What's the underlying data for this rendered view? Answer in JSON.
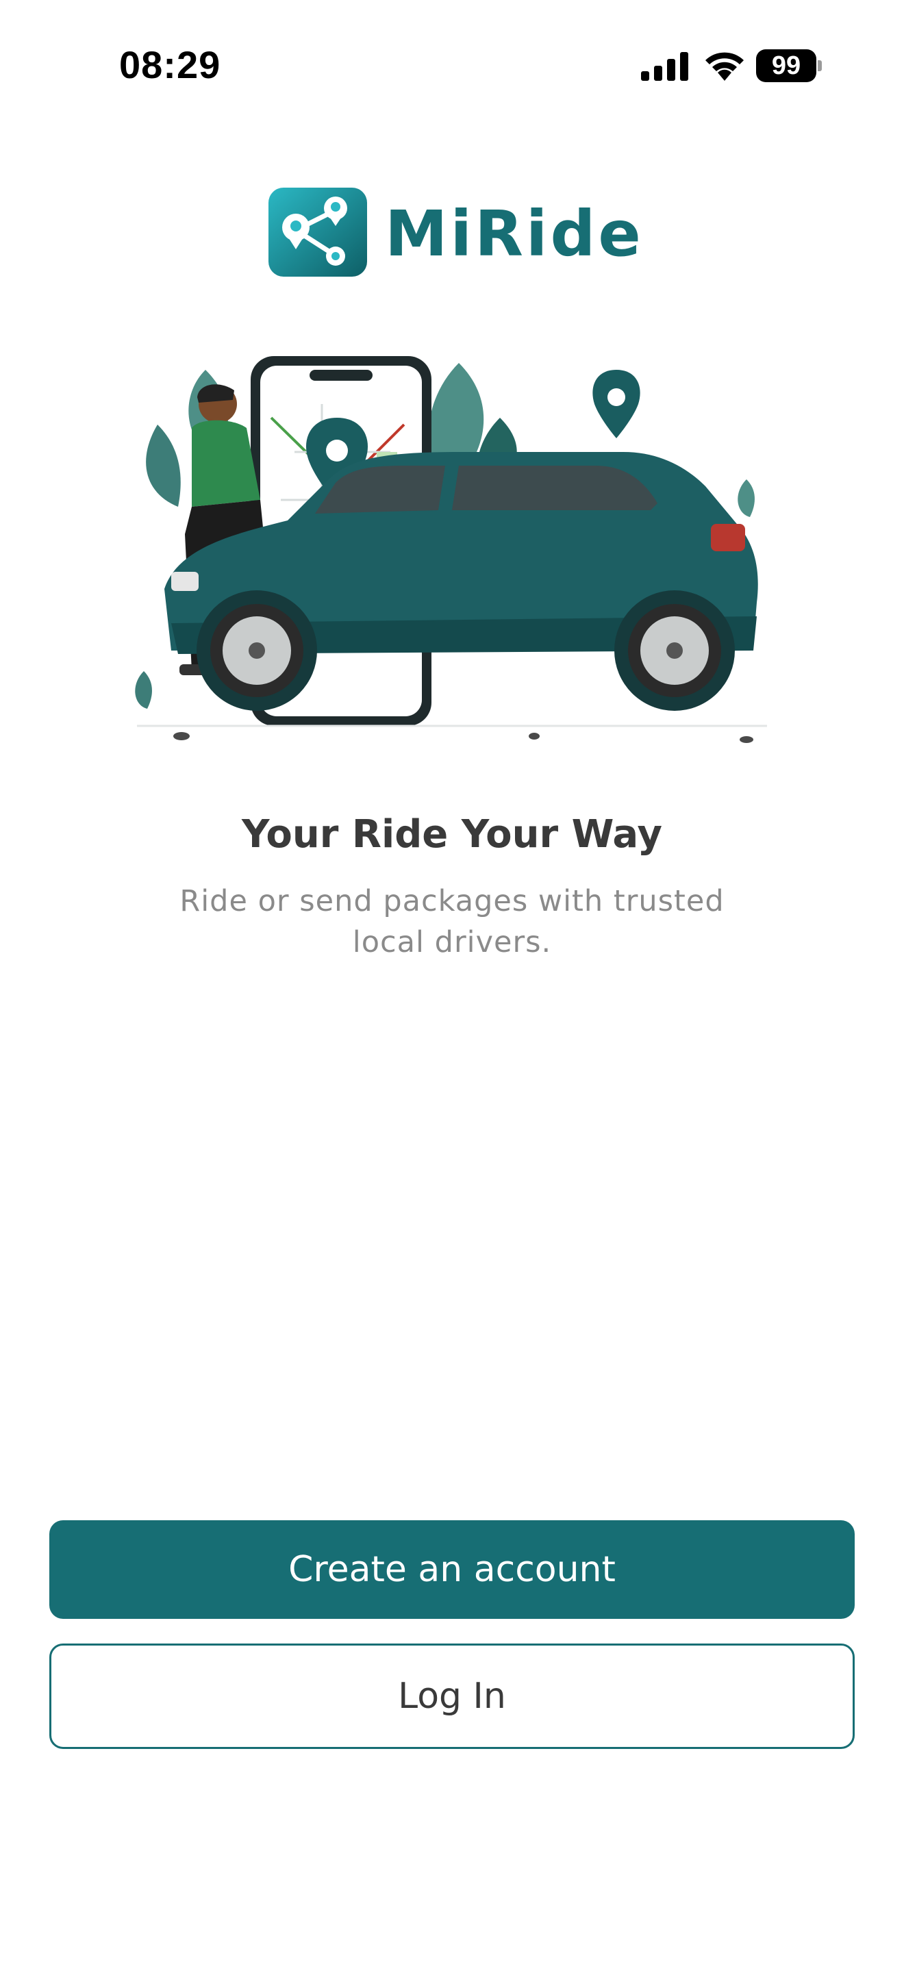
{
  "status_bar": {
    "time": "08:29",
    "battery": "99",
    "icons": [
      "signal-icon",
      "wifi-icon",
      "battery-icon"
    ]
  },
  "brand": {
    "name": "MiRide",
    "logo_icon": "route-pin-icon",
    "primary_color": "#176e74",
    "accent_color": "#2bb8c4"
  },
  "hero": {
    "illustration": "car-phone-map-illustration"
  },
  "onboarding": {
    "headline": "Your Ride Your Way",
    "subtitle": "Ride or send packages with trusted local drivers."
  },
  "actions": {
    "create_account_label": "Create an account",
    "login_label": "Log In"
  }
}
